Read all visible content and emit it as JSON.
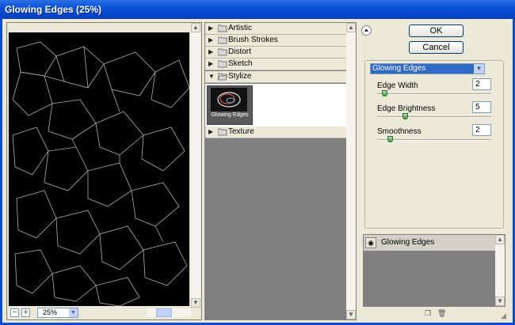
{
  "window": {
    "title": "Glowing Edges (25%)"
  },
  "preview": {
    "zoom_value": "25%",
    "zoom_out": "−",
    "zoom_in": "+"
  },
  "filter_categories": [
    {
      "label": "Artistic",
      "expanded": false
    },
    {
      "label": "Brush Strokes",
      "expanded": false
    },
    {
      "label": "Distort",
      "expanded": false
    },
    {
      "label": "Sketch",
      "expanded": false
    },
    {
      "label": "Stylize",
      "expanded": true
    },
    {
      "label": "Texture",
      "expanded": false
    }
  ],
  "stylize_thumbnail": {
    "label": "Glowing Edges",
    "selected": true
  },
  "buttons": {
    "ok": "OK",
    "cancel": "Cancel"
  },
  "settings": {
    "filter_select": "Glowing Edges",
    "params": [
      {
        "label": "Edge Width",
        "value": "2",
        "level": 0.0
      },
      {
        "label": "Edge Brightness",
        "value": "5",
        "level": 0.2
      },
      {
        "label": "Smoothness",
        "value": "2",
        "level": 0.05
      }
    ]
  },
  "layers": [
    {
      "label": "Glowing Edges",
      "visible": true
    }
  ],
  "icons": {
    "collapse": "double-chevron-up-icon",
    "new_layer": "new-effect-layer-icon",
    "delete_layer": "trash-icon",
    "eye": "eye-icon",
    "folder": "folder-icon"
  },
  "colors": {
    "title_bar": "#0a52d8",
    "dialog_bg": "#ece9d8",
    "select_highlight": "#316ac5",
    "slider_knob": "#3d9a3d"
  }
}
